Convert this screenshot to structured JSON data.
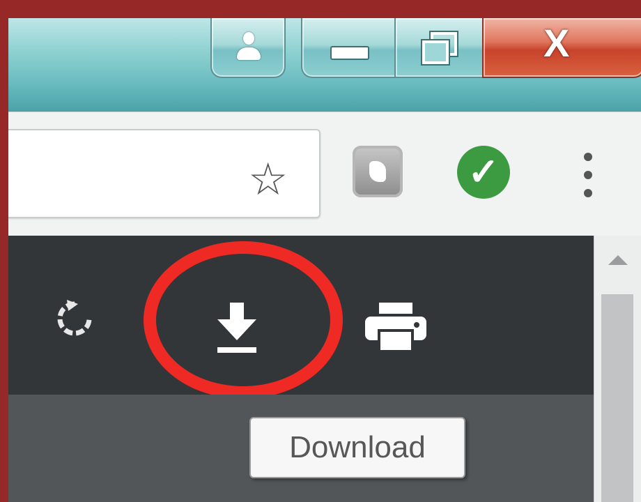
{
  "titlebar": {
    "user_button_icon": "user-icon",
    "minimize_icon": "minimize-icon",
    "restore_icon": "restore-icon",
    "close_label": "X"
  },
  "toolbar": {
    "bookmark_icon": "star-icon",
    "extension_gray_icon": "extension-icon",
    "extension_green_icon": "checkmark-icon",
    "menu_icon": "kebab-menu-icon"
  },
  "pdf_toolbar": {
    "rotate_icon": "rotate-icon",
    "download_icon": "download-icon",
    "print_icon": "print-icon",
    "tooltip": "Download"
  },
  "colors": {
    "frame": "#962828",
    "highlight": "#ef2a24",
    "pdf_toolbar": "#323639",
    "check_green": "#3c9a40"
  }
}
